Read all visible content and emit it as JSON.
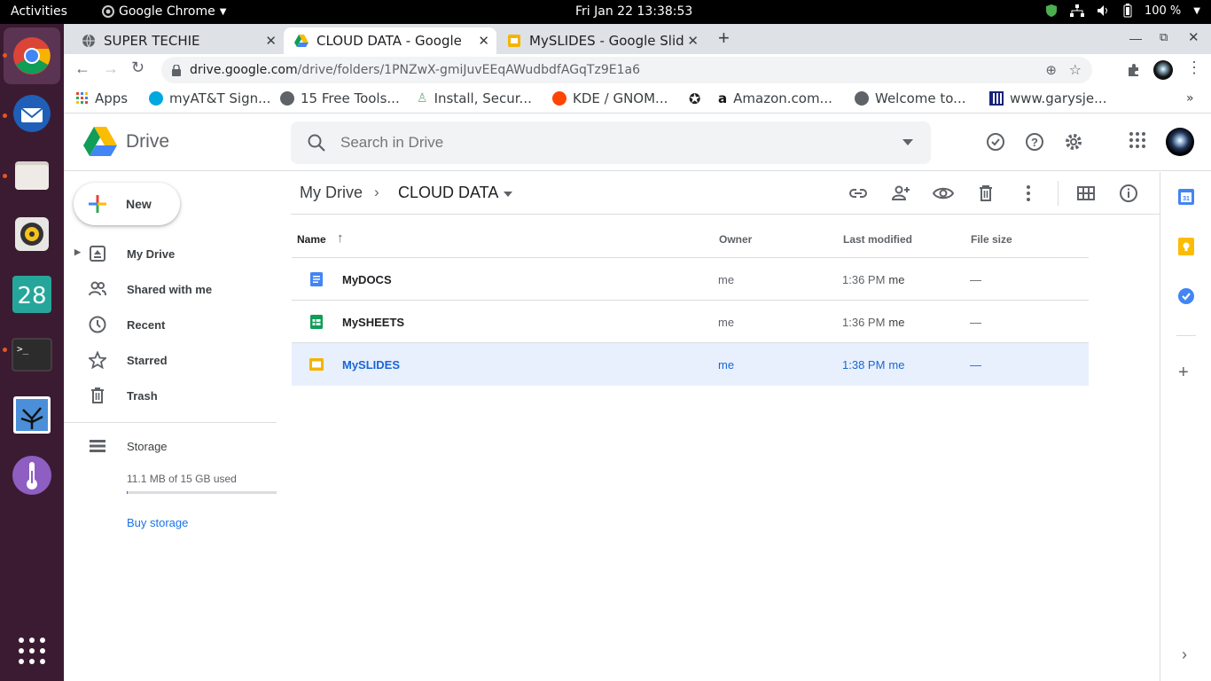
{
  "system_bar": {
    "activities": "Activities",
    "app_name": "Google Chrome",
    "clock": "Fri Jan 22  13:38:53",
    "battery": "100 %"
  },
  "browser": {
    "tabs": [
      {
        "title": "SUPER TECHIE"
      },
      {
        "title": "CLOUD DATA - Google Drive"
      },
      {
        "title": "MySLIDES - Google Slides"
      }
    ],
    "url_host": "drive.google.com",
    "url_path": "/drive/folders/1PNZwX-gmiJuvEEqAWudbdfAGqTz9E1a6",
    "bookmarks": [
      {
        "label": "Apps"
      },
      {
        "label": "myAT&T Sign..."
      },
      {
        "label": "15 Free Tools..."
      },
      {
        "label": "Install, Secur..."
      },
      {
        "label": "KDE / GNOM..."
      },
      {
        "label": ""
      },
      {
        "label": "Amazon.com..."
      },
      {
        "label": "Welcome to..."
      },
      {
        "label": "www.garysje..."
      }
    ]
  },
  "drive": {
    "logo_text": "Drive",
    "search_placeholder": "Search in Drive",
    "new_label": "New",
    "nav": [
      {
        "label": "My Drive"
      },
      {
        "label": "Shared with me"
      },
      {
        "label": "Recent"
      },
      {
        "label": "Starred"
      },
      {
        "label": "Trash"
      }
    ],
    "storage_label": "Storage",
    "storage_used": "11.1 MB of 15 GB used",
    "storage_fraction": 0.0007,
    "buy_storage": "Buy storage",
    "breadcrumb_root": "My Drive",
    "breadcrumb_current": "CLOUD DATA",
    "columns": {
      "name": "Name",
      "owner": "Owner",
      "modified": "Last modified",
      "size": "File size"
    },
    "files": [
      {
        "name": "MyDOCS",
        "type": "docs",
        "owner": "me",
        "modified": "1:36 PM",
        "modified_by": "me",
        "size": "—"
      },
      {
        "name": "MySHEETS",
        "type": "sheets",
        "owner": "me",
        "modified": "1:36 PM",
        "modified_by": "me",
        "size": "—"
      },
      {
        "name": "MySLIDES",
        "type": "slides",
        "owner": "me",
        "modified": "1:38 PM",
        "modified_by": "me",
        "size": "—",
        "selected": true
      }
    ]
  },
  "colors": {
    "accent": "#1a73e8",
    "selected_bg": "#e8f0fe",
    "dock": "#3b1b32"
  }
}
